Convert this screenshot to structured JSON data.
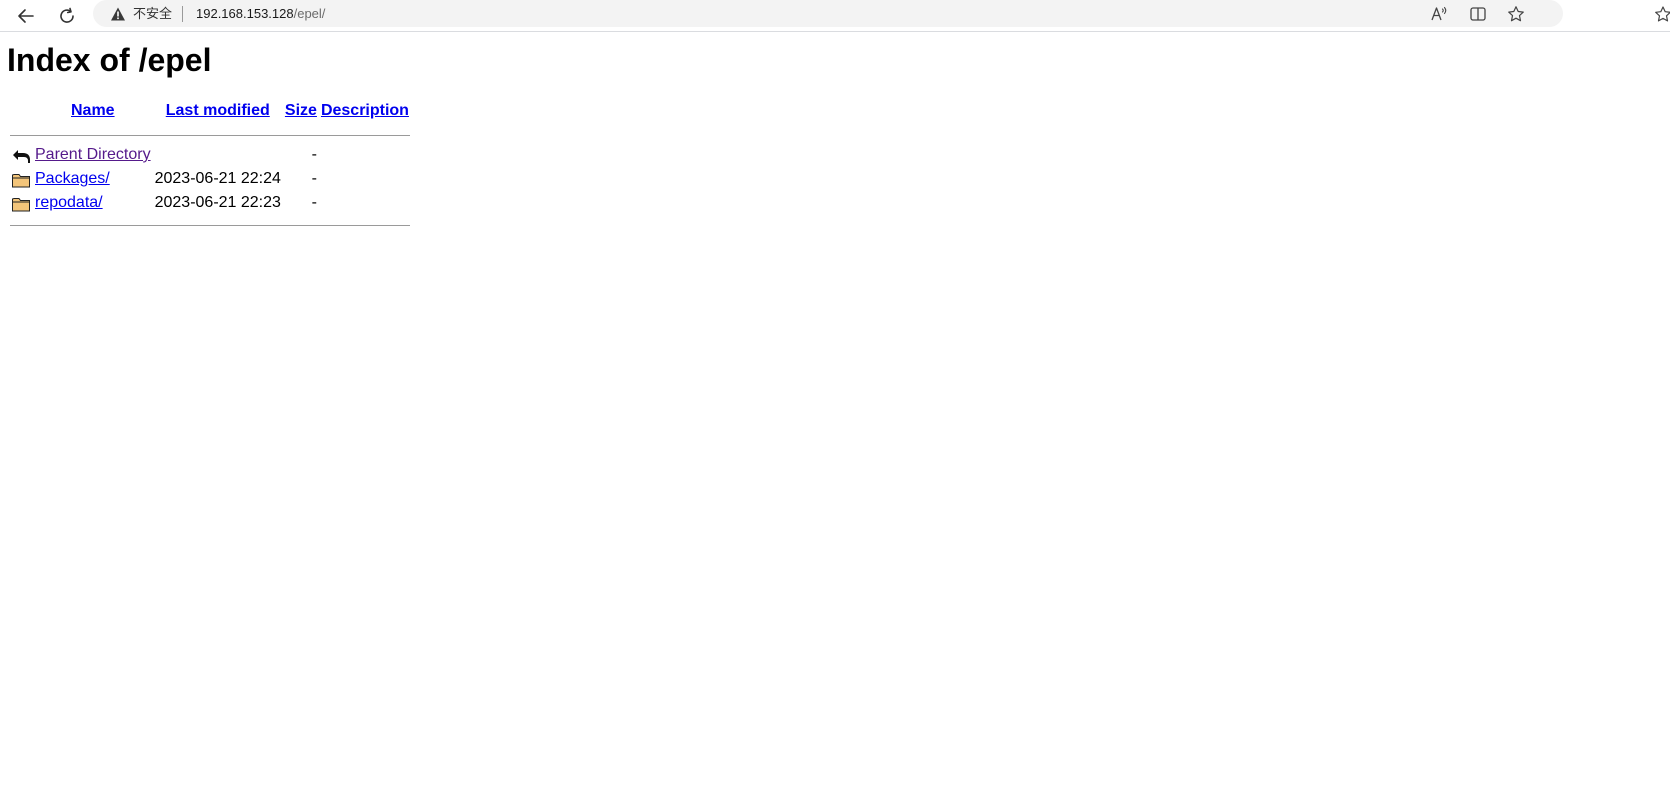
{
  "browser": {
    "security_label": "不安全",
    "url_host": "192.168.153.128",
    "url_path": "/epel/",
    "icons": {
      "back": "back-arrow-icon",
      "reload": "reload-icon",
      "security": "warning-triangle-icon",
      "read_aloud": "read-aloud-icon",
      "split_screen": "split-screen-icon",
      "favorite": "star-icon"
    }
  },
  "page": {
    "title": "Index of /epel",
    "columns": {
      "name": "Name",
      "last_modified": "Last modified",
      "size": "Size",
      "description": "Description"
    },
    "rows": [
      {
        "icon": "parent-directory-icon",
        "name": "Parent Directory",
        "last_modified": "",
        "size": "-",
        "description": ""
      },
      {
        "icon": "folder-icon",
        "name": "Packages/",
        "last_modified": "2023-06-21 22:24",
        "size": "-",
        "description": ""
      },
      {
        "icon": "folder-icon",
        "name": "repodata/",
        "last_modified": "2023-06-21 22:23",
        "size": "-",
        "description": ""
      }
    ]
  },
  "colors": {
    "link": "#0000ee",
    "visited_link": "#551a8b",
    "folder_fill": "#f3c57a",
    "toolbar_bg": "#ffffff",
    "omnibox_bg": "#f3f3f3"
  }
}
